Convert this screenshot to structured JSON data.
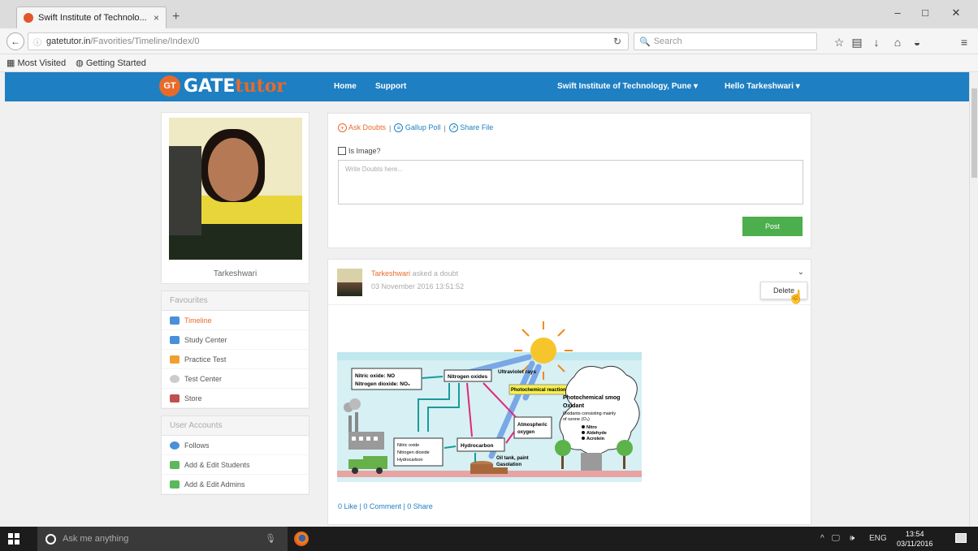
{
  "browser": {
    "tab_title": "Swift Institute of Technolo...",
    "tab_close": "×",
    "new_tab": "+",
    "window_minimize": "–",
    "window_restore": "□",
    "window_close": "✕",
    "url_host": "gatetutor.in",
    "url_path": "/Favorities/Timeline/Index/0",
    "search_placeholder": "Search",
    "bookmarks": [
      "Most Visited",
      "Getting Started"
    ]
  },
  "site": {
    "logo_badge": "GT",
    "logo_gate": "GATE",
    "logo_tutor": "tutor",
    "nav": {
      "home": "Home",
      "support": "Support",
      "institute": "Swift Institute of Technology, Pune ▾",
      "user": "Hello Tarkeshwari ▾"
    }
  },
  "profile": {
    "name": "Tarkeshwari"
  },
  "favourites": {
    "title": "Favourites",
    "items": [
      {
        "label": "Timeline",
        "icon": "timeline-icon",
        "color": "#4a90d9"
      },
      {
        "label": "Study Center",
        "icon": "study-center-icon",
        "color": "#4a90d9"
      },
      {
        "label": "Practice Test",
        "icon": "practice-test-icon",
        "color": "#f0a030"
      },
      {
        "label": "Test Center",
        "icon": "test-center-icon",
        "color": "#999999"
      },
      {
        "label": "Store",
        "icon": "store-icon",
        "color": "#c0504d"
      }
    ]
  },
  "user_accounts": {
    "title": "User Accounts",
    "items": [
      {
        "label": "Follows",
        "icon": "follows-icon",
        "color": "#4a90d9"
      },
      {
        "label": "Add & Edit Students",
        "icon": "add-students-icon",
        "color": "#5cb85c"
      },
      {
        "label": "Add & Edit Admins",
        "icon": "add-admins-icon",
        "color": "#5cb85c"
      }
    ]
  },
  "composer": {
    "ask_doubts": "Ask Doubts",
    "gallup_poll": "Gallup Poll",
    "share_file": "Share File",
    "separator": "|",
    "is_image_label": "Is Image?",
    "placeholder": "Write Doubts here...",
    "post_label": "Post"
  },
  "feed_post": {
    "author": "Tarkeshwari",
    "verb": "asked a doubt",
    "timestamp": "03 November 2016 13:51:52",
    "chevron": "⌄",
    "menu_delete": "Delete",
    "stats": "0 Like | 0 Comment | 0 Share",
    "diagram": {
      "labels": {
        "no": "Nitric oxide: NO",
        "no2": "Nitrogen dioxide: NO₂",
        "nox": "Nitrogen oxides",
        "uv": "Ultraviolet rays",
        "photo_reaction": "Photochemical reaction",
        "smog": "Photochemical smog",
        "oxidant": "Oxidant",
        "oxidant_desc1": "Oxidants consisting mainly",
        "oxidant_desc2": "of ozone (O₃)",
        "bullets": [
          "Nitro",
          "Aldehyde",
          "Acrolein"
        ],
        "atmo_oxygen_1": "Atmospheric",
        "atmo_oxygen_2": "oxygen",
        "hydrocarbon": "Hydrocarbon",
        "emissions_1": "Nitric oxide",
        "emissions_2": "Nitrogen dioxide",
        "emissions_3": "Hydrocarbon",
        "oil_1": "Oil tank, paint",
        "oil_2": "Gasolation"
      }
    }
  },
  "taskbar": {
    "search_text": "Ask me anything",
    "mic": "🎙",
    "tray_up": "^",
    "tray_network": "🖵",
    "tray_volume": "🕪",
    "tray_lang": "ENG",
    "time": "13:54",
    "date": "03/11/2016"
  }
}
